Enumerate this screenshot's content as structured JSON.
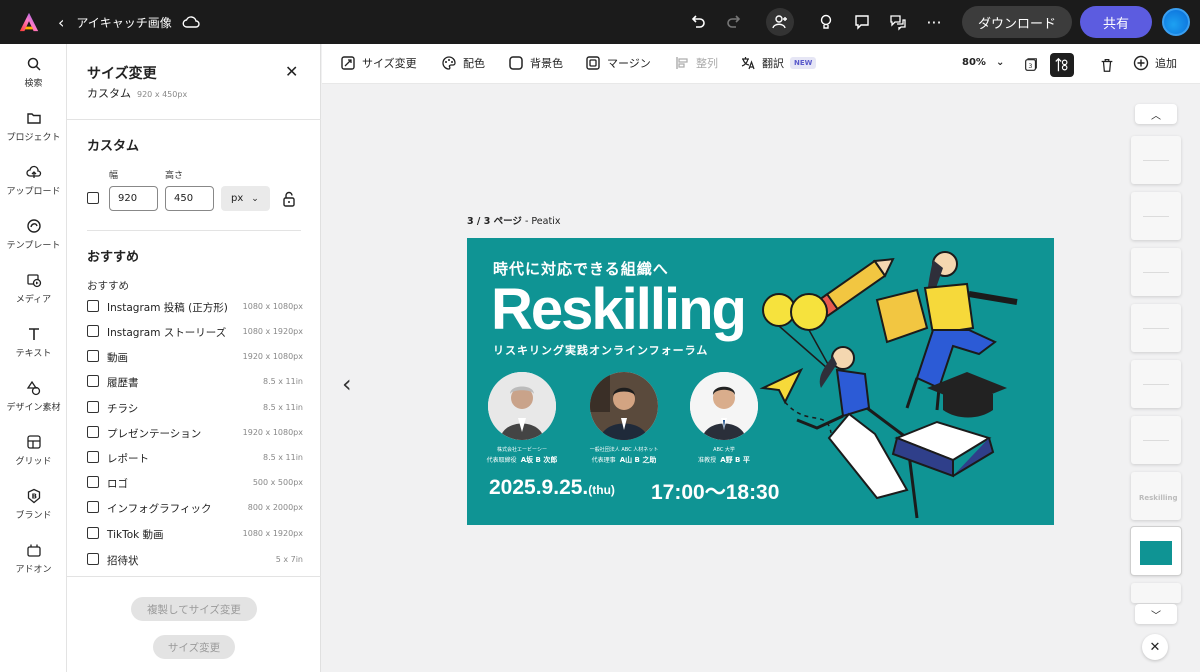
{
  "topbar": {
    "title": "アイキャッチ画像",
    "download_label": "ダウンロード",
    "share_label": "共有",
    "brand_color": "#5c5ce0"
  },
  "rail": {
    "items": [
      {
        "label": "検索",
        "icon": "search-icon"
      },
      {
        "label": "プロジェクト",
        "icon": "folder-icon"
      },
      {
        "label": "アップロード",
        "icon": "cloud-upload-icon"
      },
      {
        "label": "テンプレート",
        "icon": "template-icon"
      },
      {
        "label": "メディア",
        "icon": "media-icon"
      },
      {
        "label": "テキスト",
        "icon": "text-icon"
      },
      {
        "label": "デザイン素材",
        "icon": "shapes-icon"
      },
      {
        "label": "グリッド",
        "icon": "grid-icon"
      },
      {
        "label": "ブランド",
        "icon": "brand-icon"
      },
      {
        "label": "アドオン",
        "icon": "addon-icon"
      }
    ]
  },
  "panel": {
    "title": "サイズ変更",
    "current_label": "カスタム",
    "current_dims": "920 x 450px",
    "custom_heading": "カスタム",
    "width_label": "幅",
    "height_label": "高さ",
    "width_value": "920",
    "height_value": "450",
    "unit": "px",
    "recommend_heading": "おすすめ",
    "recommend_sub": "おすすめ",
    "presets": [
      {
        "name": "Instagram 投稿 (正方形)",
        "dims": "1080 x 1080px"
      },
      {
        "name": "Instagram ストーリーズ",
        "dims": "1080 x 1920px"
      },
      {
        "name": "動画",
        "dims": "1920 x 1080px"
      },
      {
        "name": "履歴書",
        "dims": "8.5 x 11in"
      },
      {
        "name": "チラシ",
        "dims": "8.5 x 11in"
      },
      {
        "name": "プレゼンテーション",
        "dims": "1920 x 1080px"
      },
      {
        "name": "レポート",
        "dims": "8.5 x 11in"
      },
      {
        "name": "ロゴ",
        "dims": "500 x 500px"
      },
      {
        "name": "インフォグラフィック",
        "dims": "800 x 2000px"
      },
      {
        "name": "TikTok 動画",
        "dims": "1080 x 1920px"
      },
      {
        "name": "招待状",
        "dims": "5 x 7in"
      }
    ],
    "duplicate_resize_label": "複製してサイズ変更",
    "resize_label": "サイズ変更"
  },
  "toolbar": {
    "resize": "サイズ変更",
    "color": "配色",
    "background": "背景色",
    "margin": "マージン",
    "align": "整列",
    "translate": "翻訳",
    "new_badge": "NEW",
    "zoom": "80%",
    "add": "追加"
  },
  "canvas": {
    "page_label_bold": "3 / 3 ページ",
    "page_label_rest": " - Peatix"
  },
  "banner": {
    "bg_color": "#0f9494",
    "tagline": "時代に対応できる組織へ",
    "title": "Reskilling",
    "subtitle": "リスキリング実践オンラインフォーラム",
    "speakers": [
      {
        "org": "株式会社エービーシー",
        "role": "代表取締役",
        "name": "A坂 B 次郎"
      },
      {
        "org": "一般社団法人 ABC 人材ネット",
        "role": "代表理事",
        "name": "A山 B 之助"
      },
      {
        "org": "ABC 大学",
        "role": "准教授",
        "name": "A野 B 平"
      }
    ],
    "date": "2025.9.25.",
    "day": "(thu)",
    "time": "17:00〜18:30"
  },
  "thumbnails": {
    "mini_text": "Reskilling"
  }
}
